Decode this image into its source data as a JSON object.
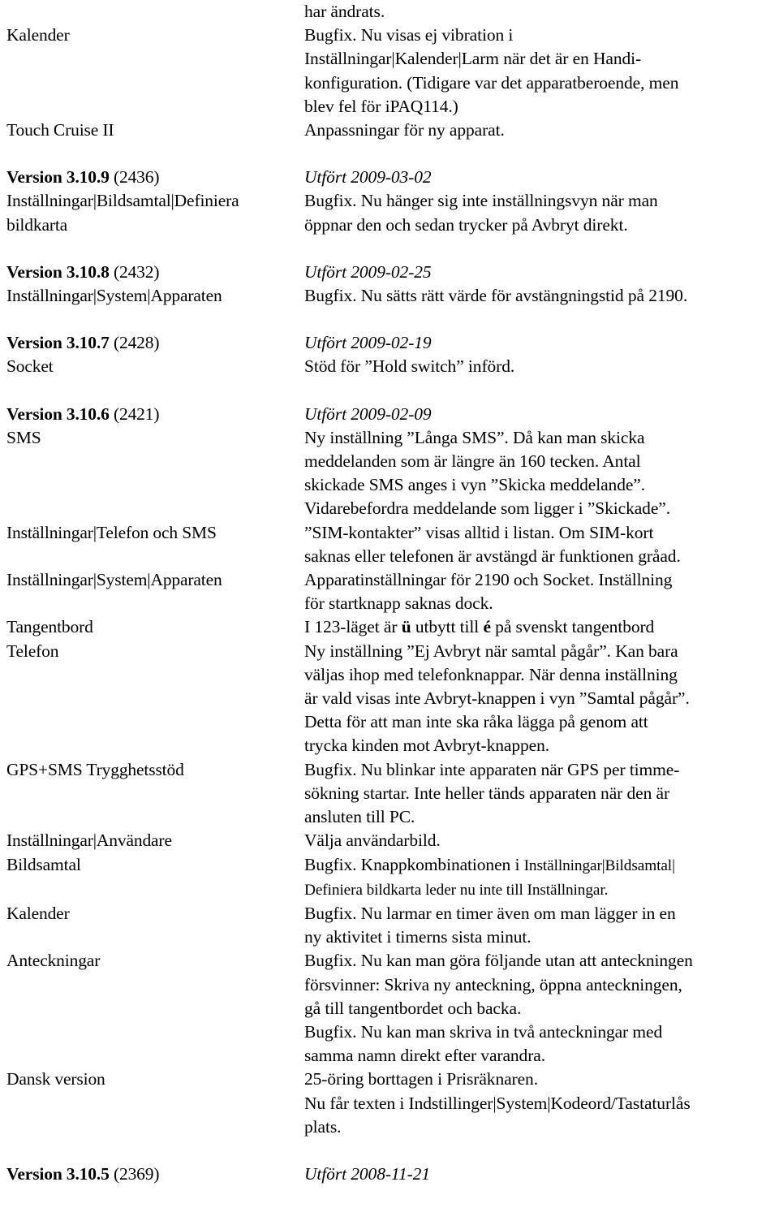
{
  "document": {
    "type": "release-notes-changelog",
    "language": "sv",
    "continued_from_previous_page": true
  },
  "continuation": {
    "orphan_line": "har ändrats."
  },
  "sections": [
    {
      "id": "continuation",
      "is_version_header": false,
      "rows": [
        {
          "left": "Kalender",
          "right_lines": [
            "Bugfix. Nu visas ej vibration i",
            "Inställningar|Kalender|Larm när det är en Handi-",
            "konfiguration. (Tidigare var det apparatberoende, men",
            "blev fel för iPAQ114.)"
          ]
        },
        {
          "left": "Touch Cruise II",
          "right_lines": [
            "Anpassningar för ny apparat."
          ]
        }
      ]
    },
    {
      "id": "v3.10.9",
      "is_version_header": true,
      "version_label": "Version 3.10.9",
      "build": "(2436)",
      "status": "Utfört 2009-03-02",
      "rows": [
        {
          "left": "Inställningar|Bildsamtal|Definiera bildkarta",
          "left_lines": [
            "Inställningar|Bildsamtal|Definiera",
            "bildkarta"
          ],
          "right_lines": [
            "Bugfix. Nu hänger sig inte inställningsvyn när man",
            "öppnar den och sedan trycker på Avbryt direkt."
          ]
        }
      ]
    },
    {
      "id": "v3.10.8",
      "is_version_header": true,
      "version_label": "Version 3.10.8",
      "build": "(2432)",
      "status": "Utfört 2009-02-25",
      "rows": [
        {
          "left": "Inställningar|System|Apparaten",
          "left_lines": [
            "Inställningar|System|Apparaten"
          ],
          "right_lines": [
            "Bugfix. Nu sätts rätt värde för avstängningstid på 2190."
          ]
        }
      ]
    },
    {
      "id": "v3.10.7",
      "is_version_header": true,
      "version_label": "Version 3.10.7",
      "build": "(2428)",
      "status": "Utfört 2009-02-19",
      "rows": [
        {
          "left": "Socket",
          "left_lines": [
            "Socket"
          ],
          "right_lines": [
            "Stöd för ”Hold switch” införd."
          ]
        }
      ]
    },
    {
      "id": "v3.10.6",
      "is_version_header": true,
      "version_label": "Version 3.10.6",
      "build": "(2421)",
      "status": "Utfört 2009-02-09",
      "rows": [
        {
          "left": "SMS",
          "left_lines": [
            "SMS"
          ],
          "right_lines": [
            "Ny inställning ”Långa SMS”. Då kan man skicka",
            "meddelanden som är längre än 160 tecken. Antal",
            "skickade SMS anges i vyn ”Skicka meddelande”.",
            "Vidarebefordra meddelande som ligger i ”Skickade”."
          ]
        },
        {
          "left": "Inställningar|Telefon och SMS",
          "left_lines": [
            "Inställningar|Telefon och SMS"
          ],
          "right_lines": [
            "”SIM-kontakter” visas alltid i listan. Om SIM-kort",
            "saknas eller telefonen är avstängd är funktionen gråad."
          ]
        },
        {
          "left": "Inställningar|System|Apparaten",
          "left_lines": [
            "Inställningar|System|Apparaten"
          ],
          "right_lines": [
            "Apparatinställningar för 2190 och Socket. Inställning",
            "för startknapp saknas dock."
          ]
        },
        {
          "left": "Tangentbord",
          "left_lines": [
            "Tangentbord"
          ],
          "right_rich": [
            [
              {
                "t": "I 123-läget är ",
                "b": false
              },
              {
                "t": "ü",
                "b": true
              },
              {
                "t": " utbytt till ",
                "b": false
              },
              {
                "t": "é",
                "b": true
              },
              {
                "t": " på svenskt tangentbord",
                "b": false
              }
            ]
          ]
        },
        {
          "left": "Telefon",
          "left_lines": [
            "Telefon"
          ],
          "right_lines": [
            "Ny inställning ”Ej Avbryt när samtal pågår”. Kan bara",
            "väljas ihop med telefonknappar. När denna inställning",
            "är vald visas inte Avbryt-knappen i vyn ”Samtal pågår”.",
            "Detta för att man inte ska råka lägga på genom att",
            "trycka kinden mot Avbryt-knappen."
          ]
        },
        {
          "left": "GPS+SMS Trygghetsstöd",
          "left_lines": [
            "GPS+SMS Trygghetsstöd"
          ],
          "right_lines": [
            "Bugfix. Nu blinkar inte apparaten när GPS per timme-",
            "sökning startar. Inte heller tänds apparaten när den är",
            "ansluten till PC."
          ]
        },
        {
          "left": "Inställningar|Användare",
          "left_lines": [
            "Inställningar|Användare"
          ],
          "right_lines": [
            "Välja användarbild."
          ]
        },
        {
          "left": "Bildsamtal",
          "left_lines": [
            "Bildsamtal"
          ],
          "right_rich": [
            [
              {
                "t": "Bugfix. Knappkombinationen i ",
                "b": false
              },
              {
                "t": "Inställningar|Bildsamtal|",
                "b": false,
                "small": true
              }
            ],
            [
              {
                "t": "Definiera bildkarta leder nu inte till Inställningar.",
                "b": false,
                "small": true
              }
            ]
          ]
        },
        {
          "left": "Kalender",
          "left_lines": [
            "Kalender"
          ],
          "right_lines": [
            "Bugfix. Nu larmar en timer även om man lägger in en",
            "ny aktivitet i timerns sista minut."
          ]
        },
        {
          "left": "Anteckningar",
          "left_lines": [
            "Anteckningar"
          ],
          "right_lines": [
            "Bugfix. Nu kan man göra följande utan att anteckningen",
            "försvinner: Skriva ny anteckning, öppna anteckningen,",
            "gå till tangentbordet och backa.",
            "Bugfix. Nu kan man skriva in två anteckningar med",
            "samma namn direkt efter varandra."
          ]
        },
        {
          "left": "Dansk version",
          "left_lines": [
            "Dansk version"
          ],
          "right_lines": [
            "25-öring borttagen i Prisräknaren.",
            "Nu får texten i Indstillinger|System|Kodeord/Tastaturlås",
            "plats."
          ]
        }
      ]
    },
    {
      "id": "v3.10.5",
      "is_version_header": true,
      "version_label": "Version 3.10.5",
      "build": "(2369)",
      "status": "Utfört 2008-11-21",
      "rows": []
    }
  ]
}
